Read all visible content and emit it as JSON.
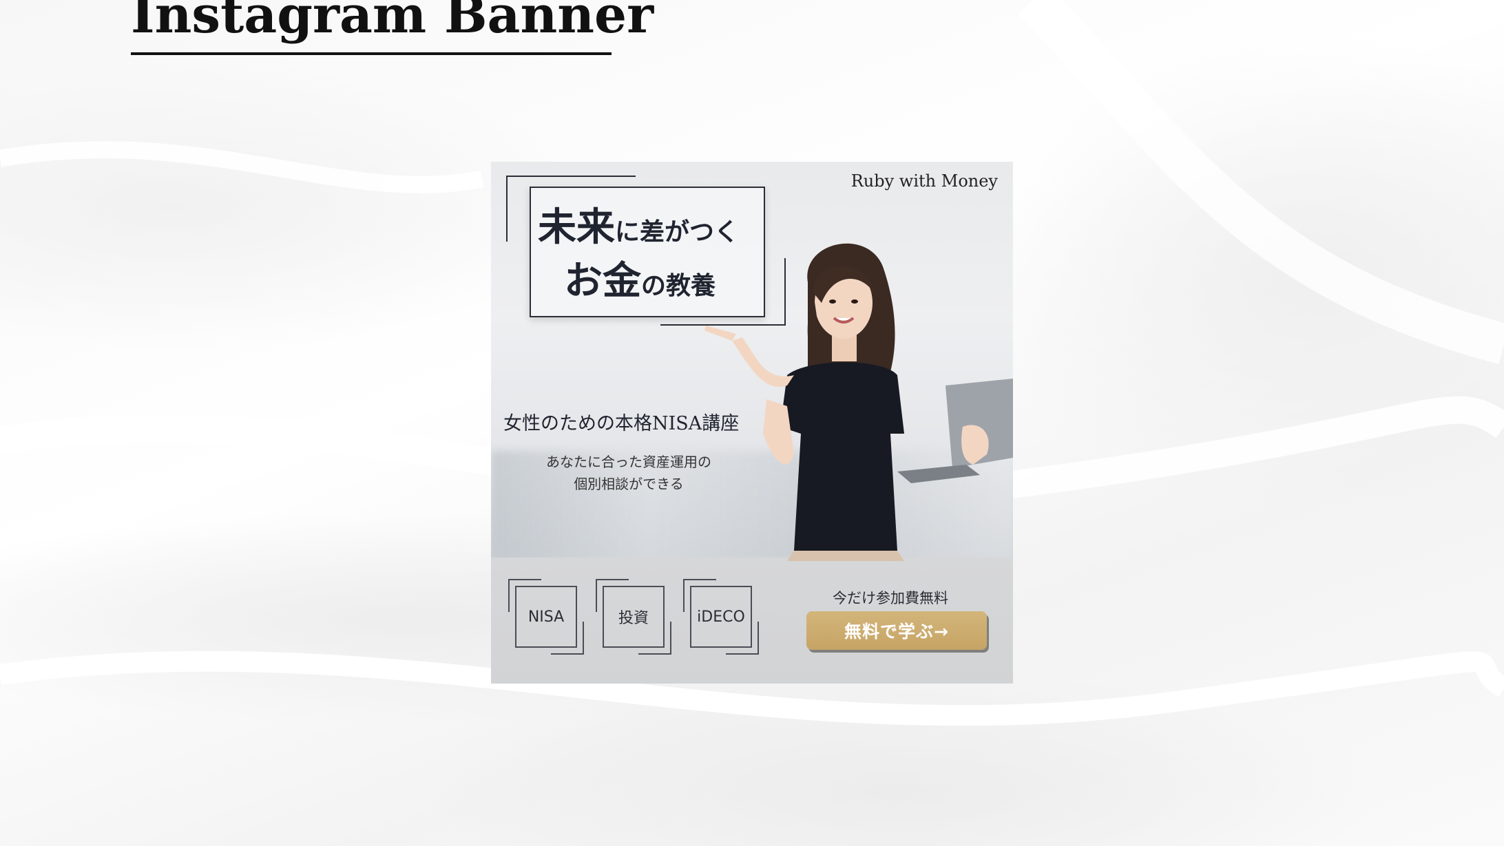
{
  "page": {
    "title": "Instagram Banner"
  },
  "banner": {
    "brand": "Ruby with Money",
    "headline": {
      "line1_big": "未来",
      "line1_small": "に差がつく",
      "line2_big": "お金",
      "line2_small": "の教養"
    },
    "course_title": "女性のための本格NISA講座",
    "course_sub_line1": "あなたに合った資産運用の",
    "course_sub_line2": "個別相談ができる",
    "tags": [
      "NISA",
      "投資",
      "iDECO"
    ],
    "cta_note": "今だけ参加費無料",
    "cta_button": "無料で学ぶ→"
  },
  "colors": {
    "accent_gold": "#c9a86a",
    "text_navy": "#1f2430"
  }
}
